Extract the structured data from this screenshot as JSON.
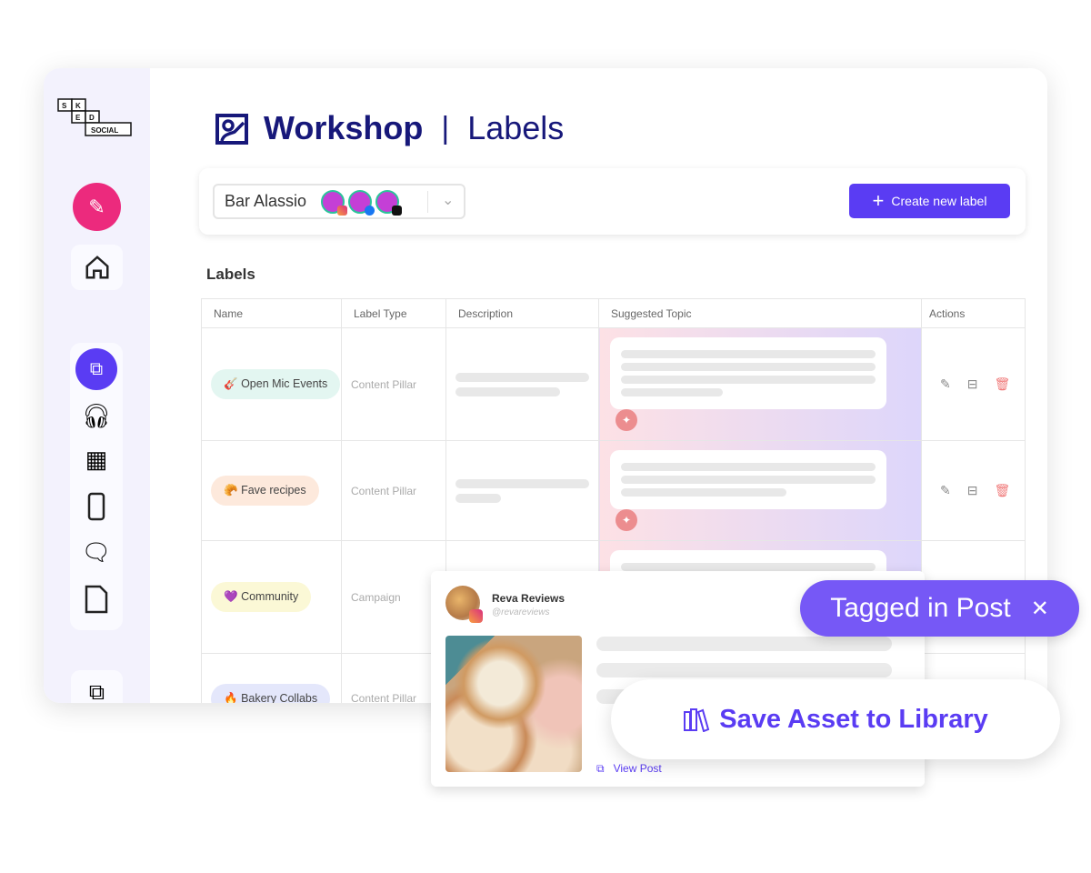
{
  "logo": {
    "text": "SKED SOCIAL"
  },
  "header": {
    "title": "Workshop",
    "separator": "|",
    "subtitle": "Labels"
  },
  "account": {
    "name": "Bar Alassio",
    "networks": [
      "instagram",
      "facebook",
      "tiktok"
    ]
  },
  "create_button": "Create new label",
  "section_title": "Labels",
  "table": {
    "columns": [
      "Name",
      "Label Type",
      "Description",
      "Suggested Topic",
      "Actions"
    ],
    "rows": [
      {
        "emoji": "🎸",
        "name": "Open Mic Events",
        "type": "Content Pillar",
        "color": "#e3f6f1"
      },
      {
        "emoji": "🥐",
        "name": "Fave recipes",
        "type": "Content Pillar",
        "color": "#fde9dc"
      },
      {
        "emoji": "💜",
        "name": "Community",
        "type": "Campaign",
        "color": "#fbf8d6"
      },
      {
        "emoji": "🔥",
        "name": "Bakery Collabs",
        "type": "Content Pillar",
        "color": "#e4e7fb"
      }
    ]
  },
  "post": {
    "author": "Reva Reviews",
    "handle": "@revareviews",
    "view_link": "View Post"
  },
  "tagged": {
    "label": "Tagged in Post",
    "close": "✕"
  },
  "save": {
    "label": "Save Asset to Library"
  },
  "colors": {
    "accent": "#5a3cf3",
    "navy": "#17187a",
    "pink": "#ec2a7d"
  }
}
